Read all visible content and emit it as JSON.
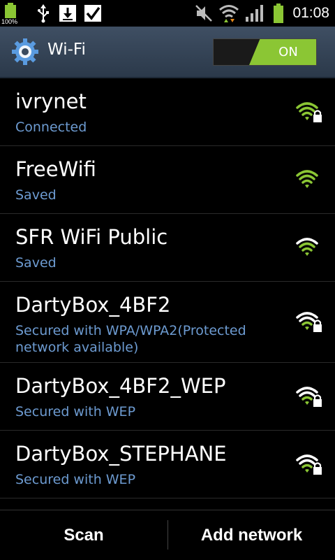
{
  "status_bar": {
    "battery_left_label": "100%",
    "time": "01:08",
    "icons": [
      "battery-full-icon",
      "usb-icon",
      "download-icon",
      "checkbox-icon",
      "mute-icon",
      "wifi-status-icon",
      "cell-signal-icon",
      "battery-icon"
    ]
  },
  "title_bar": {
    "title": "Wi-Fi",
    "toggle_label": "ON",
    "toggle_color": "#8bc634"
  },
  "networks": [
    {
      "name": "ivrynet",
      "status": "Connected",
      "strength": 4,
      "locked": true,
      "signal_color": "#8bc634"
    },
    {
      "name": "FreeWifi",
      "status": "Saved",
      "strength": 4,
      "locked": false,
      "signal_color": "#8bc634"
    },
    {
      "name": "SFR WiFi Public",
      "status": "Saved",
      "strength": 3,
      "locked": false,
      "signal_color": "#8bc634"
    },
    {
      "name": "DartyBox_4BF2",
      "status": "Secured with WPA/WPA2(Protected network available)",
      "strength": 2,
      "locked": true,
      "signal_color": "#8bc634"
    },
    {
      "name": "DartyBox_4BF2_WEP",
      "status": "Secured with WEP",
      "strength": 2,
      "locked": true,
      "signal_color": "#8bc634"
    },
    {
      "name": "DartyBox_STEPHANE",
      "status": "Secured with WEP",
      "strength": 2,
      "locked": true,
      "signal_color": "#8bc634"
    }
  ],
  "bottom_bar": {
    "scan_label": "Scan",
    "add_label": "Add network"
  },
  "colors": {
    "status_text": "#6d9bd1",
    "accent": "#8bc634"
  }
}
